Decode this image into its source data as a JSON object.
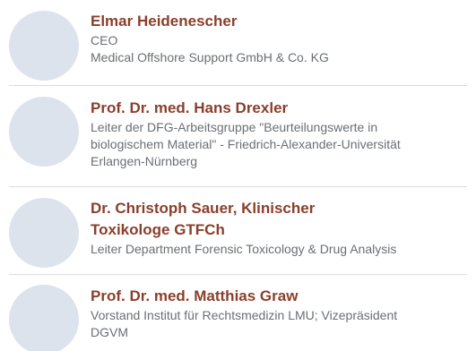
{
  "speakers": [
    {
      "name": "Elmar Heidenescher",
      "lines": [
        "CEO",
        "Medical Offshore Support GmbH & Co. KG"
      ]
    },
    {
      "name": "Prof. Dr. med. Hans Drexler",
      "lines": [
        "Leiter der DFG-Arbeitsgruppe \"Beurteilungswerte in",
        "biologischem Material\" - Friedrich-Alexander-Universität",
        "Erlangen-Nürnberg"
      ]
    },
    {
      "name_lines": [
        "Dr. Christoph Sauer, Klinischer",
        "Toxikologe GTFCh"
      ],
      "lines": [
        "Leiter Department Forensic Toxicology & Drug Analysis"
      ]
    },
    {
      "name": "Prof. Dr. med. Matthias Graw",
      "lines": [
        "Vorstand Institut für Rechtsmedizin LMU; Vizepräsident",
        "DGVM"
      ]
    }
  ]
}
